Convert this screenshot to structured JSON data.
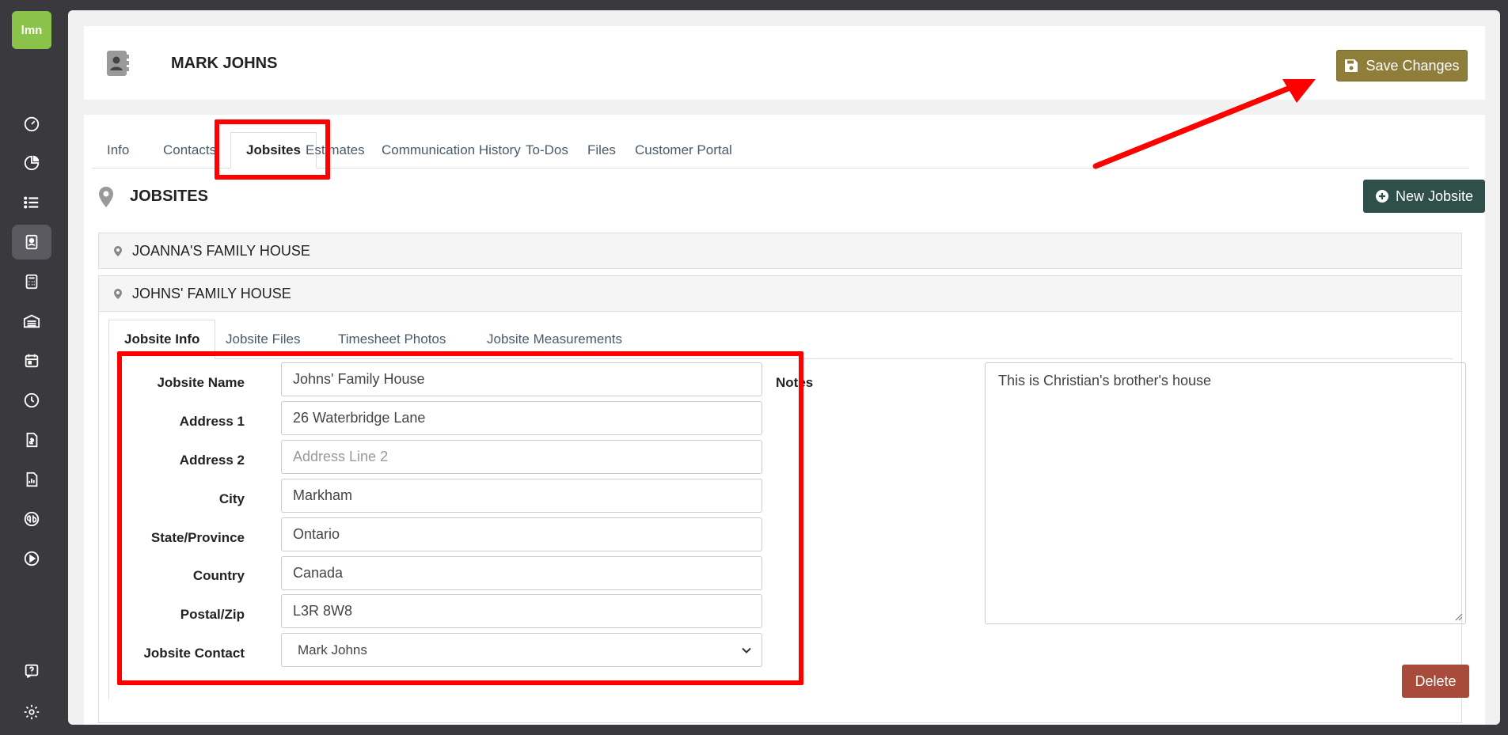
{
  "app": {
    "logo_text": "lmn"
  },
  "sidebar": {
    "icons": [
      "dashboard-icon",
      "pie-chart-icon",
      "list-icon",
      "contacts-icon",
      "calculator-icon",
      "warehouse-icon",
      "calendar-icon",
      "clock-icon",
      "invoice-icon",
      "report-icon",
      "quickbooks-icon",
      "play-icon",
      "help-icon",
      "settings-icon"
    ],
    "active": "contacts-icon"
  },
  "header": {
    "title": "MARK JOHNS",
    "save_label": "Save Changes"
  },
  "tabs": {
    "items": [
      "Info",
      "Contacts",
      "Jobsites",
      "Estimates",
      "Communication History",
      "To-Dos",
      "Files",
      "Customer Portal"
    ],
    "active": "Jobsites"
  },
  "jobsites": {
    "title": "JOBSITES",
    "new_label": "New Jobsite",
    "items": [
      "JOANNA'S FAMILY HOUSE",
      "JOHNS' FAMILY HOUSE"
    ]
  },
  "jobsite_tabs": {
    "items": [
      "Jobsite Info",
      "Jobsite Files",
      "Timesheet Photos",
      "Jobsite Measurements"
    ],
    "active": "Jobsite Info"
  },
  "form": {
    "jobsite_name": {
      "label": "Jobsite Name",
      "value": "Johns' Family House"
    },
    "address1": {
      "label": "Address 1",
      "value": "26 Waterbridge Lane"
    },
    "address2": {
      "label": "Address 2",
      "value": "",
      "placeholder": "Address Line 2"
    },
    "city": {
      "label": "City",
      "value": "Markham"
    },
    "state": {
      "label": "State/Province",
      "value": "Ontario"
    },
    "country": {
      "label": "Country",
      "value": "Canada"
    },
    "postal": {
      "label": "Postal/Zip",
      "value": "L3R 8W8"
    },
    "contact": {
      "label": "Jobsite Contact",
      "value": "Mark Johns"
    },
    "notes": {
      "label": "Notes",
      "value": "This is Christian's brother's house"
    },
    "delete_label": "Delete"
  },
  "colors": {
    "brand_green": "#8bc34a",
    "save_button": "#8f7e3a",
    "new_button": "#2f4f4a",
    "delete_button": "#a84b3a",
    "annotation_red": "#ff0000"
  }
}
